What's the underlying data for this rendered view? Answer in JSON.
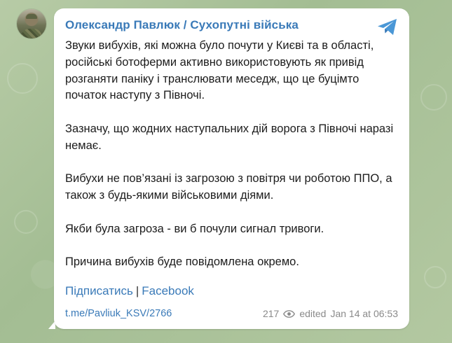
{
  "channel": {
    "name": "Олександр Павлюк / Сухопутні війська"
  },
  "message": {
    "paragraphs": [
      "Звуки вибухів, які можна було почути у Києві та в області, російські ботоферми активно використовують як привід розганяти паніку і транслювати меседж, що це буцімто початок наступу з Півночі.",
      "Зазначу, що жодних наступальних дій ворога з Півночі наразі немає.",
      "Вибухи не пов’язані із загрозою з повітря чи роботою ППО, а також з будь-якими військовими діями.",
      "Якби була загроза - ви б почули сигнал тривоги.",
      "Причина вибухів буде повідомлена окремо."
    ]
  },
  "links": {
    "subscribe": "Підписатись",
    "separator": "|",
    "facebook": "Facebook"
  },
  "footer": {
    "post_link": "t.me/Pavliuk_KSV/2766",
    "views": "217",
    "edited": "edited",
    "date": "Jan 14 at 06:53"
  },
  "icons": {
    "telegram": "telegram-plane-icon",
    "views": "eye-icon"
  },
  "colors": {
    "accent": "#3a7ab8",
    "background": "#a9c29a",
    "meta": "#8a8a8a"
  }
}
